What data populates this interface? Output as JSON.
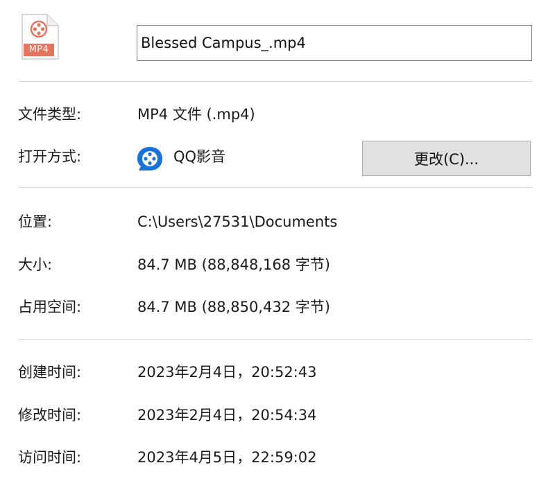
{
  "header": {
    "file_icon": {
      "name": "mp4-file-icon",
      "label": "MP4",
      "accent_color": "#e5735d"
    },
    "file_name": "Blessed Campus_.mp4"
  },
  "rows": {
    "file_type": {
      "label": "文件类型:",
      "value": "MP4 文件 (.mp4)"
    },
    "opens_with": {
      "label": "打开方式:",
      "app_name": "QQ影音",
      "app_icon": "qq-player-icon",
      "app_icon_color": "#1a73d9",
      "change_button_label": "更改(C)..."
    },
    "location": {
      "label": "位置:",
      "value": "C:\\Users\\27531\\Documents"
    },
    "size": {
      "label": "大小:",
      "value": "84.7 MB (88,848,168 字节)"
    },
    "size_on_disk": {
      "label": "占用空间:",
      "value": "84.7 MB (88,850,432 字节)"
    },
    "created": {
      "label": "创建时间:",
      "value": "2023年2月4日，20:52:43"
    },
    "modified": {
      "label": "修改时间:",
      "value": "2023年2月4日，20:54:34"
    },
    "accessed": {
      "label": "访问时间:",
      "value": "2023年4月5日，22:59:02"
    }
  }
}
